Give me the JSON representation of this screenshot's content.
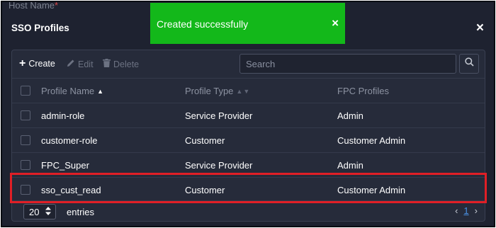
{
  "background": {
    "field_label": "Host Name",
    "required_mark": "*"
  },
  "dialog": {
    "title": "SSO Profiles",
    "close_glyph": "×"
  },
  "toast": {
    "message": "Created successfully",
    "close_glyph": "×",
    "color": "#13b81a"
  },
  "toolbar": {
    "create_label": "Create",
    "edit_label": "Edit",
    "delete_label": "Delete",
    "search_placeholder": "Search",
    "search_value": ""
  },
  "table": {
    "columns": [
      "Profile Name",
      "Profile Type",
      "FPC Profiles"
    ],
    "rows": [
      {
        "name": "admin-role",
        "type": "Service Provider",
        "fpc": "Admin",
        "selected": false
      },
      {
        "name": "customer-role",
        "type": "Customer",
        "fpc": "Customer Admin",
        "selected": false
      },
      {
        "name": "FPC_Super",
        "type": "Service Provider",
        "fpc": "Admin",
        "selected": false
      },
      {
        "name": "sso_cust_read",
        "type": "Customer",
        "fpc": "Customer Admin",
        "selected": false
      }
    ],
    "highlight_color": "#e01f26"
  },
  "pagination": {
    "page_size": "20",
    "entries_label": "entries",
    "current_page": "1",
    "prev_glyph": "‹",
    "next_glyph": "›"
  },
  "colors": {
    "background": "#1e2230",
    "panel": "#262b3a",
    "accent_link": "#4a90e2"
  }
}
